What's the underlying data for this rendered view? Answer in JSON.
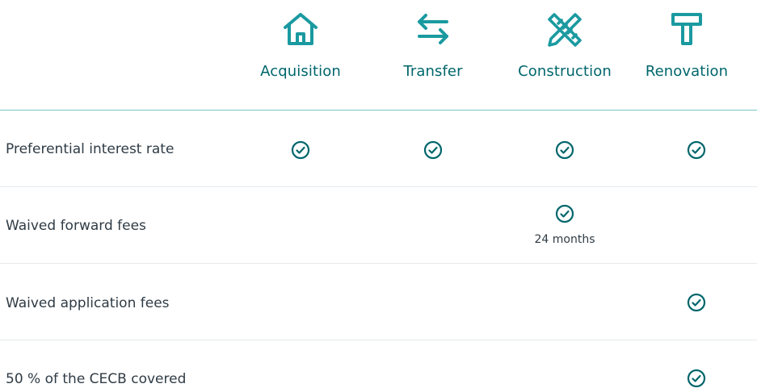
{
  "columns": [
    {
      "label": "Acquisition",
      "icon": "house-icon"
    },
    {
      "label": "Transfer",
      "icon": "transfer-arrows-icon"
    },
    {
      "label": "Construction",
      "icon": "ruler-pencil-icon"
    },
    {
      "label": "Renovation",
      "icon": "hammer-icon"
    }
  ],
  "rows": [
    {
      "label": "Preferential interest rate",
      "checks": [
        true,
        true,
        true,
        true
      ]
    },
    {
      "label": "Waived forward fees",
      "checks": [
        false,
        false,
        true,
        false
      ],
      "notes": [
        "",
        "",
        "24 months",
        ""
      ]
    },
    {
      "label": "Waived application fees",
      "checks": [
        false,
        false,
        false,
        true
      ]
    },
    {
      "label": "50 % of the CECB covered",
      "checks": [
        false,
        false,
        false,
        true
      ]
    }
  ],
  "icons": {
    "check": "check-circle-icon"
  },
  "colors": {
    "accent": "#00666b",
    "icon": "#1a9aa0",
    "rule": "#78c2c4",
    "divider": "#e5eaec",
    "text": "#2f3b45"
  }
}
